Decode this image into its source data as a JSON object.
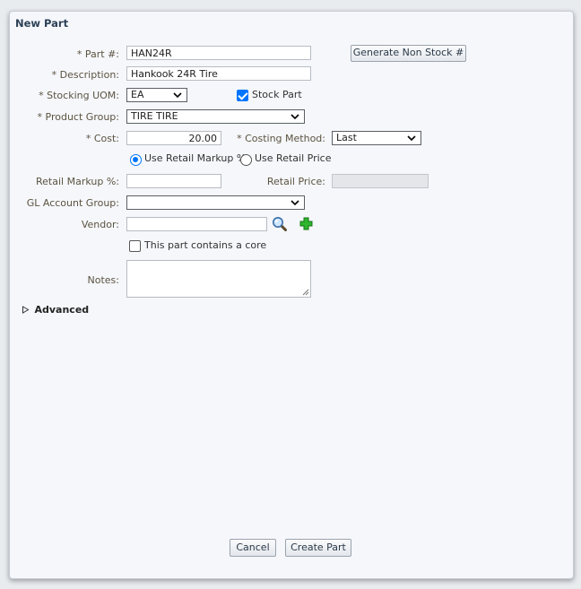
{
  "dialog": {
    "title": "New Part"
  },
  "form": {
    "part_number": {
      "label": "* Part #:",
      "value": "HAN24R"
    },
    "generate_button": "Generate Non Stock #",
    "description": {
      "label": "* Description:",
      "value": "Hankook 24R Tire"
    },
    "stocking_uom": {
      "label": "* Stocking UOM:",
      "value": "EA"
    },
    "stock_part": {
      "label": "Stock Part",
      "checked": true
    },
    "product_group": {
      "label": "* Product Group:",
      "value": "TIRE TIRE"
    },
    "cost": {
      "label": "* Cost:",
      "value": "20.00"
    },
    "costing_method": {
      "label": "* Costing Method:",
      "value": "Last"
    },
    "use_retail_markup": {
      "label": "Use Retail Markup %",
      "checked": true
    },
    "use_retail_price": {
      "label": "Use Retail Price",
      "checked": false
    },
    "retail_markup": {
      "label": "Retail Markup %:",
      "value": ""
    },
    "retail_price": {
      "label": "Retail Price:",
      "value": ""
    },
    "gl_account_group": {
      "label": "GL Account Group:",
      "value": ""
    },
    "vendor": {
      "label": "Vendor:",
      "value": ""
    },
    "core": {
      "label": "This part contains a core",
      "checked": false
    },
    "notes": {
      "label": "Notes:",
      "value": ""
    },
    "advanced": {
      "label": "Advanced"
    }
  },
  "footer": {
    "cancel": "Cancel",
    "create": "Create Part"
  },
  "icons": {
    "search": "magnifier-icon",
    "add": "green-plus-icon",
    "expand": "triangle-right-icon",
    "dropdown": "chevron-down-icon"
  },
  "colors": {
    "accent": "#0075ff",
    "label": "#5c5340",
    "title": "#2d4156",
    "add": "#1fa51f"
  }
}
